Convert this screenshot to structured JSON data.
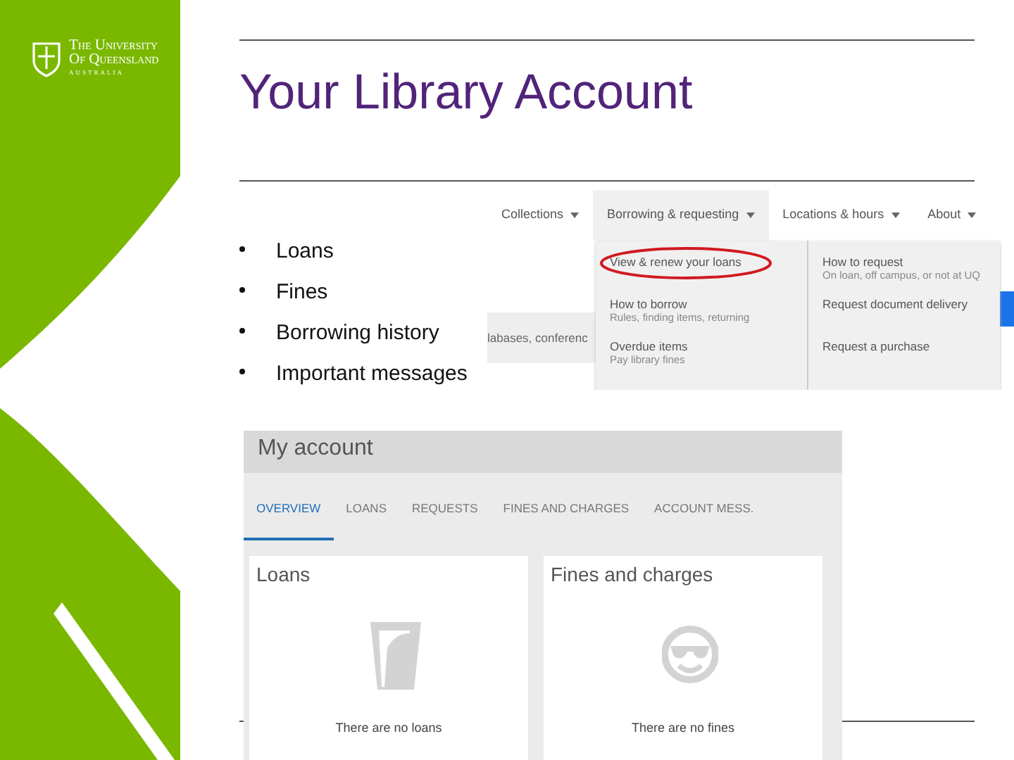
{
  "logo": {
    "lines": [
      "The University",
      "Of Queensland",
      "AUSTRALIA"
    ]
  },
  "title": "Your Library Account",
  "bullets": [
    "Loans",
    "Fines",
    "Borrowing history",
    "Important messages"
  ],
  "menu_screenshot": {
    "nav": [
      {
        "label": "Collections",
        "selected": false
      },
      {
        "label": "Borrowing & requesting",
        "selected": true
      },
      {
        "label": "Locations & hours",
        "selected": false
      },
      {
        "label": "About",
        "selected": false
      }
    ],
    "background_text": "labases, conferenc",
    "dropdown_left": [
      {
        "title": "View & renew your loans",
        "circled": true
      },
      {
        "title": "How to borrow",
        "subtitle": "Rules, finding items, returning",
        "circled": false
      },
      {
        "title": "Overdue items",
        "subtitle": "Pay library fines",
        "circled": false
      }
    ],
    "dropdown_right": [
      {
        "title": "How to request",
        "subtitle": "On loan, off campus, or not at UQ"
      },
      {
        "title": "Request document delivery"
      },
      {
        "title": "Request a purchase"
      }
    ]
  },
  "account_screenshot": {
    "heading": "My account",
    "tabs": [
      {
        "label": "OVERVIEW",
        "selected": true
      },
      {
        "label": "LOANS",
        "selected": false
      },
      {
        "label": "REQUESTS",
        "selected": false
      },
      {
        "label": "FINES AND CHARGES",
        "selected": false
      },
      {
        "label": "ACCOUNT MESS.",
        "selected": false
      }
    ],
    "cards": [
      {
        "title": "Loans",
        "kind": "glass",
        "message": "There are no loans"
      },
      {
        "title": "Fines and charges",
        "kind": "smiley",
        "message": "There are no fines"
      }
    ]
  }
}
